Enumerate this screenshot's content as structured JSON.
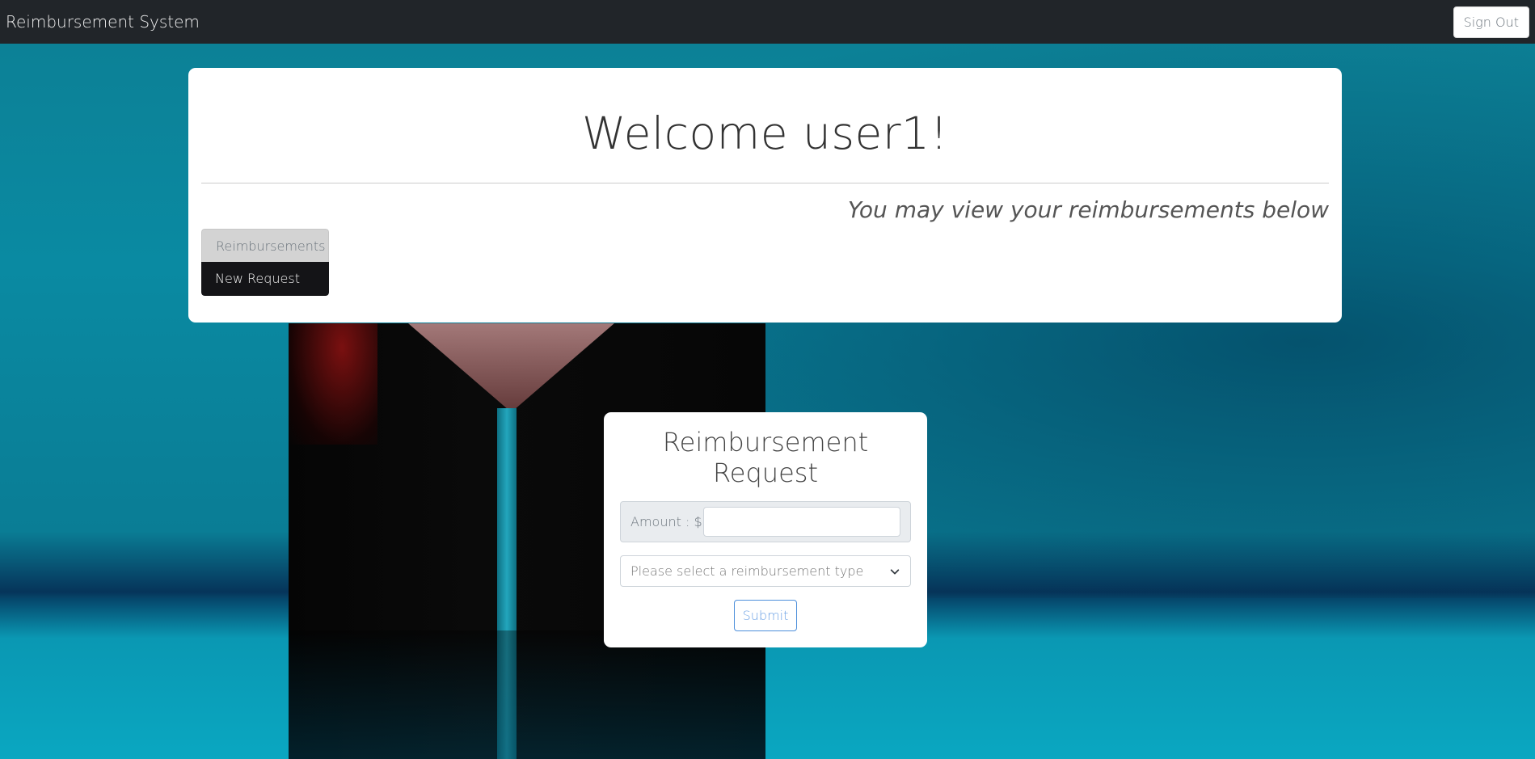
{
  "navbar": {
    "brand": "Reimbursement System",
    "sign_out_label": "Sign Out"
  },
  "welcome": {
    "title": "Welcome user1!",
    "subtitle": "You may view your reimbursements below",
    "tabs": [
      {
        "label": "Reimbursements"
      },
      {
        "label": "New Request"
      }
    ]
  },
  "request_form": {
    "title": "Reimbursement Request",
    "amount_label": "Amount : $",
    "amount_value": "",
    "type_select_value": "Please select a reimbursement type",
    "submit_label": "Submit"
  },
  "icons": {
    "select_caret": "chevron-down-icon"
  }
}
